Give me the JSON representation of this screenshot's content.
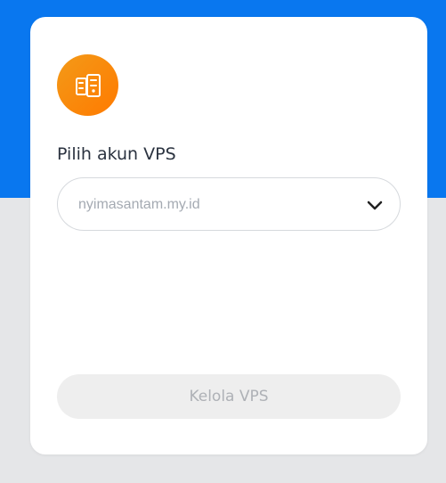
{
  "header": {
    "background_color": "#0977ef"
  },
  "card": {
    "icon": "server-icon",
    "icon_colors": {
      "start": "#f39a18",
      "end": "#ff7a00"
    },
    "label": "Pilih akun VPS",
    "select": {
      "value": "nyimasantam.my.id",
      "chevron": "chevron-down-icon"
    },
    "button": {
      "label": "Kelola VPS",
      "state": "disabled",
      "background": "#eeeeee",
      "text_color": "#aeb1b6"
    }
  },
  "page": {
    "background_color": "#e5e6e8"
  }
}
